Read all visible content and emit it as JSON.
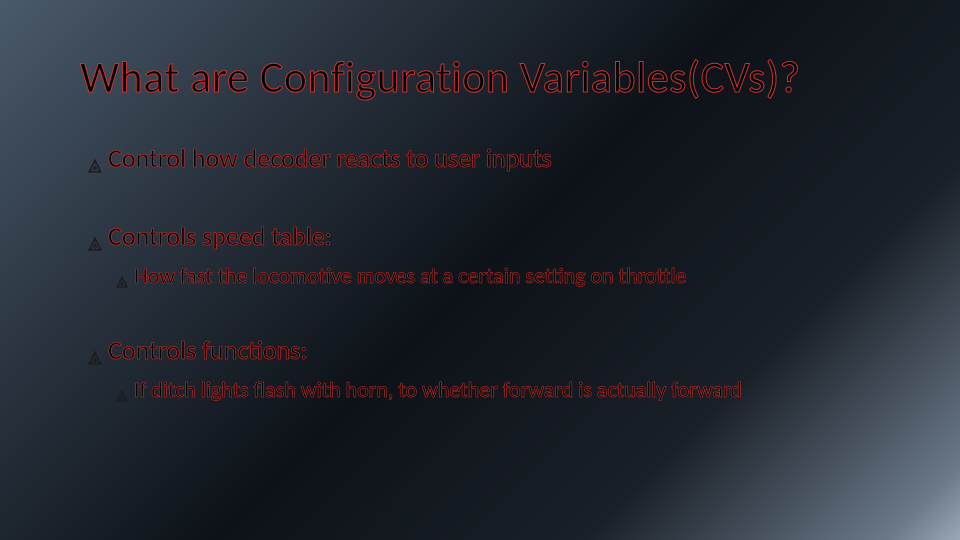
{
  "title": "What are Configuration Variables(CVs)?",
  "items": [
    {
      "text": "Control how decoder reacts to user inputs",
      "sub": []
    },
    {
      "text": "Controls speed table:",
      "sub": [
        {
          "text": "How fast the locomotive moves at a certain setting on throttle"
        }
      ]
    },
    {
      "text": "Controls functions:",
      "sub": [
        {
          "text": "If ditch lights flash with horn, to whether forward is actually forward"
        }
      ]
    }
  ]
}
